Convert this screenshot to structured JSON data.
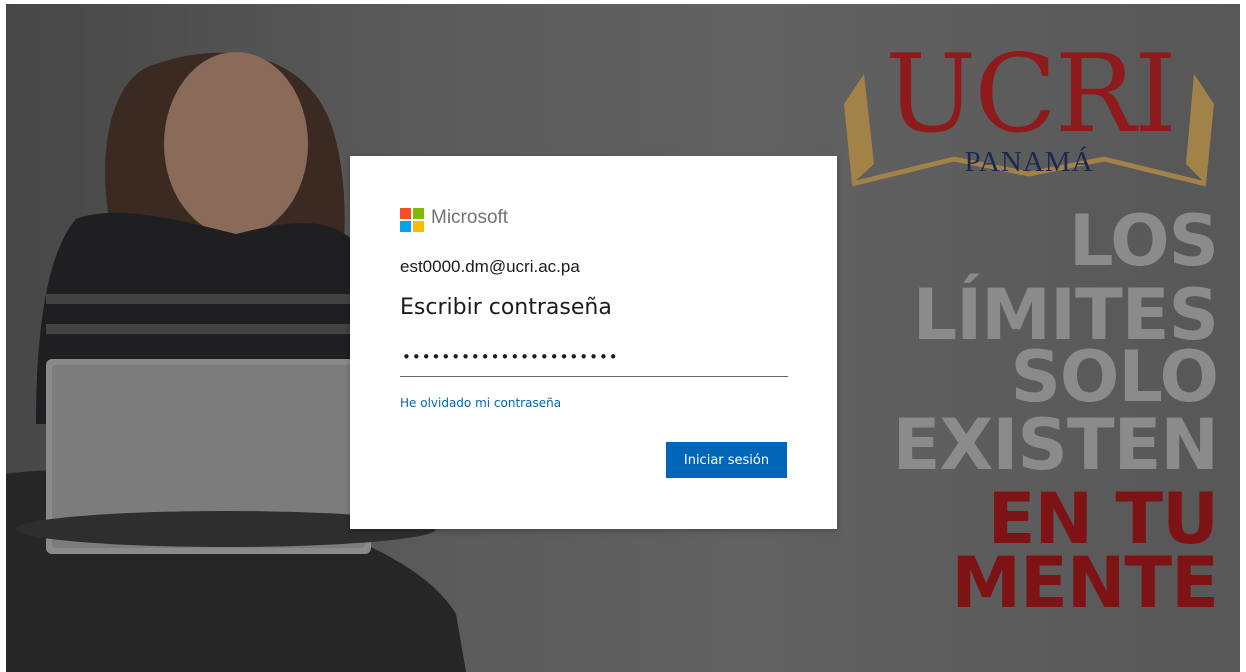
{
  "background": {
    "brand": {
      "name": "UCRI",
      "subtitle": "PANAMÁ"
    },
    "slogan": {
      "lines_light": [
        "LOS",
        "LÍMITES",
        "SOLO",
        "EXISTEN"
      ],
      "lines_red": [
        "EN TU",
        "MENTE"
      ]
    }
  },
  "login": {
    "provider": "Microsoft",
    "account": "est0000.dm@ucri.ac.pa",
    "heading": "Escribir contraseña",
    "password_value": "••••••••••••••••••••••",
    "forgot_link": "He olvidado mi contraseña",
    "signin_button": "Iniciar sesión"
  },
  "colors": {
    "accent_blue": "#0067b8",
    "brand_red": "#8e1a1c",
    "brand_navy": "#1b2a4e",
    "ms_red": "#f25022",
    "ms_green": "#7fba00",
    "ms_blue": "#00a4ef",
    "ms_yellow": "#ffb900"
  }
}
